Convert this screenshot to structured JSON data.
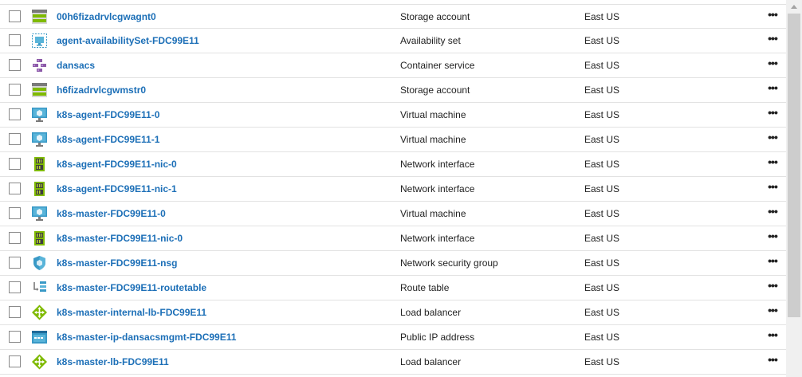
{
  "resources": [
    {
      "name": "00h6fizadrvlcgwagnt0",
      "type": "Storage account",
      "location": "East US",
      "icon": "storage-account-icon"
    },
    {
      "name": "agent-availabilitySet-FDC99E11",
      "type": "Availability set",
      "location": "East US",
      "icon": "availability-set-icon"
    },
    {
      "name": "dansacs",
      "type": "Container service",
      "location": "East US",
      "icon": "container-service-icon"
    },
    {
      "name": "h6fizadrvlcgwmstr0",
      "type": "Storage account",
      "location": "East US",
      "icon": "storage-account-icon"
    },
    {
      "name": "k8s-agent-FDC99E11-0",
      "type": "Virtual machine",
      "location": "East US",
      "icon": "virtual-machine-icon"
    },
    {
      "name": "k8s-agent-FDC99E11-1",
      "type": "Virtual machine",
      "location": "East US",
      "icon": "virtual-machine-icon"
    },
    {
      "name": "k8s-agent-FDC99E11-nic-0",
      "type": "Network interface",
      "location": "East US",
      "icon": "network-interface-icon"
    },
    {
      "name": "k8s-agent-FDC99E11-nic-1",
      "type": "Network interface",
      "location": "East US",
      "icon": "network-interface-icon"
    },
    {
      "name": "k8s-master-FDC99E11-0",
      "type": "Virtual machine",
      "location": "East US",
      "icon": "virtual-machine-icon"
    },
    {
      "name": "k8s-master-FDC99E11-nic-0",
      "type": "Network interface",
      "location": "East US",
      "icon": "network-interface-icon"
    },
    {
      "name": "k8s-master-FDC99E11-nsg",
      "type": "Network security group",
      "location": "East US",
      "icon": "network-security-group-icon"
    },
    {
      "name": "k8s-master-FDC99E11-routetable",
      "type": "Route table",
      "location": "East US",
      "icon": "route-table-icon"
    },
    {
      "name": "k8s-master-internal-lb-FDC99E11",
      "type": "Load balancer",
      "location": "East US",
      "icon": "load-balancer-icon"
    },
    {
      "name": "k8s-master-ip-dansacsmgmt-FDC99E11",
      "type": "Public IP address",
      "location": "East US",
      "icon": "public-ip-address-icon"
    },
    {
      "name": "k8s-master-lb-FDC99E11",
      "type": "Load balancer",
      "location": "East US",
      "icon": "load-balancer-icon"
    }
  ],
  "row_actions_label": "•••",
  "colors": {
    "link": "#1c6fb7",
    "row_border": "#e2e2e2",
    "storage_green": "#7fba00",
    "vm_blue": "#3999c6",
    "nic_green": "#7fba00",
    "purple": "#8c5aa8"
  }
}
